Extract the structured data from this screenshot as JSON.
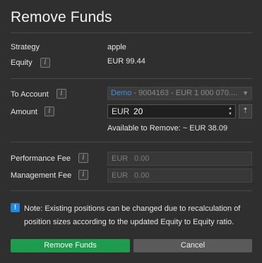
{
  "dialog": {
    "title": "Remove Funds"
  },
  "strategy": {
    "label": "Strategy",
    "value": "apple"
  },
  "equity": {
    "label": "Equity",
    "value": "EUR 99.44"
  },
  "to_account": {
    "label": "To Account",
    "selected_prefix": "Demo",
    "selected_rest": " - 9004163 - EUR 1 000 070...."
  },
  "amount": {
    "label": "Amount",
    "currency": "EUR",
    "value": "20",
    "available": "Available to Remove: ~ EUR 38.09"
  },
  "performance_fee": {
    "label": "Performance Fee",
    "currency": "EUR",
    "value": "0.00"
  },
  "management_fee": {
    "label": "Management Fee",
    "currency": "EUR",
    "value": "0.00"
  },
  "note": {
    "icon": "!",
    "text": "Note: Existing positions can be changed due to recalculation of position sizes according to the updated Equity to Equity ratio."
  },
  "buttons": {
    "confirm_label": "Remove Funds",
    "cancel_label": "Cancel"
  },
  "icons": {
    "info": "i",
    "dropdown": "▼",
    "spin_up": "▲",
    "spin_down": "▼",
    "max": "⇡"
  },
  "colors": {
    "background": "#2f2f2f",
    "accent_green": "#1f9b4e",
    "link_blue": "#3d8fe0",
    "note_blue": "#1e88e5"
  }
}
